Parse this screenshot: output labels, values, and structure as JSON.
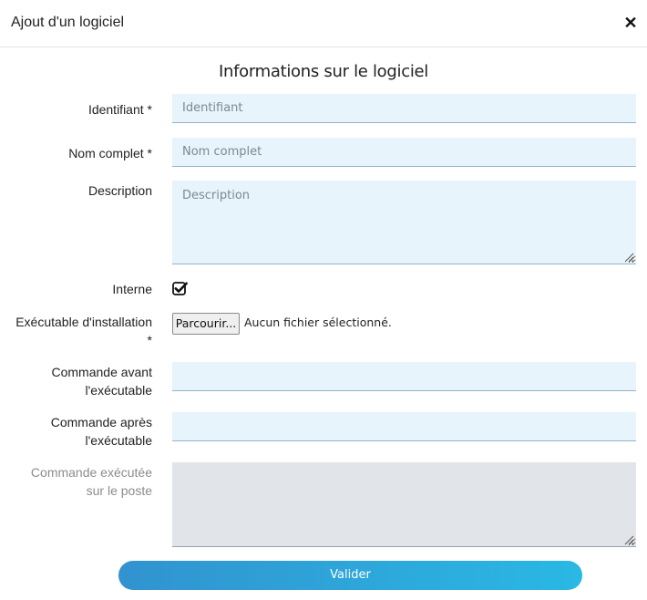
{
  "dialog": {
    "title": "Ajout d'un logiciel",
    "close_icon": "close-icon"
  },
  "form": {
    "section_title": "Informations sur le logiciel",
    "identifiant": {
      "label": "Identifiant *",
      "value": "",
      "placeholder": "Identifiant"
    },
    "nom_complet": {
      "label": "Nom complet *",
      "value": "",
      "placeholder": "Nom complet"
    },
    "description": {
      "label": "Description",
      "value": "",
      "placeholder": "Description"
    },
    "interne": {
      "label": "Interne",
      "checked": true
    },
    "executable": {
      "label_line1": "Exécutable d'installation",
      "label_line2": "*",
      "browse_label": "Parcourir...",
      "file_status": "Aucun fichier sélectionné."
    },
    "commande_avant": {
      "label_line1": "Commande avant",
      "label_line2": "l'exécutable",
      "value": ""
    },
    "commande_apres": {
      "label_line1": "Commande après",
      "label_line2": "l'exécutable",
      "value": ""
    },
    "commande_executee": {
      "label_line1": "Commande exécutée",
      "label_line2": "sur le poste",
      "value": "",
      "disabled": true
    },
    "submit_label": "Valider"
  },
  "colors": {
    "field_bg": "#e8f4fb",
    "disabled_bg": "#e1e4e8",
    "button_gradient_start": "#3193cf",
    "button_gradient_end": "#2ab8e4"
  }
}
